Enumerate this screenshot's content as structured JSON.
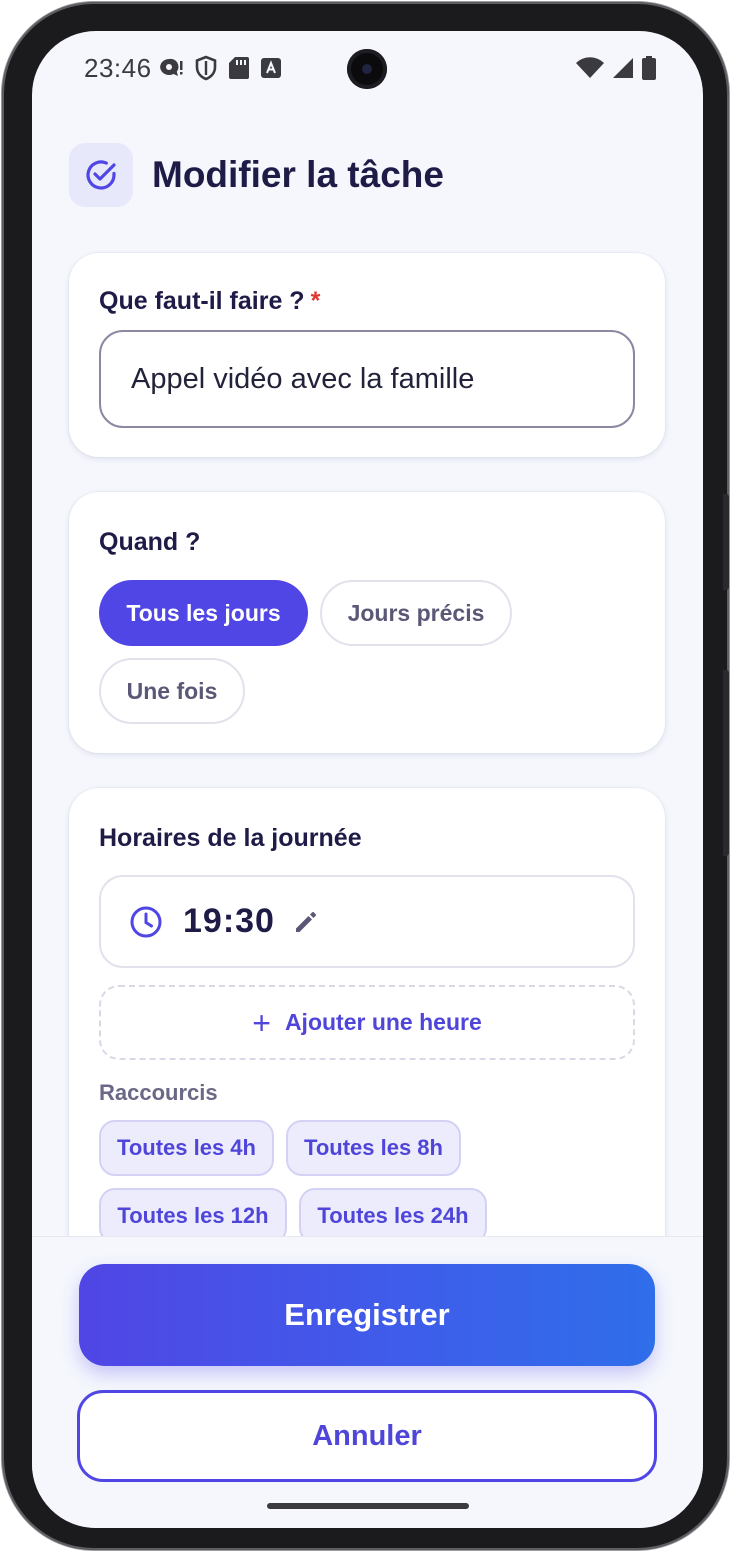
{
  "status_bar": {
    "time": "23:46"
  },
  "header": {
    "title": "Modifier la tâche",
    "icon": "check-circle-icon"
  },
  "task_card": {
    "label": "Que faut-il faire ?",
    "required_mark": "*",
    "value": "Appel vidéo avec la famille"
  },
  "when_card": {
    "label": "Quand ?",
    "options": [
      {
        "label": "Tous les jours",
        "selected": true
      },
      {
        "label": "Jours précis",
        "selected": false
      },
      {
        "label": "Une fois",
        "selected": false
      }
    ]
  },
  "schedule_card": {
    "label": "Horaires de la journée",
    "times": [
      {
        "value": "19:30"
      }
    ],
    "add_label": "Ajouter une heure",
    "add_plus": "+",
    "shortcuts_label": "Raccourcis",
    "shortcuts": [
      "Toutes les 4h",
      "Toutes les 8h",
      "Toutes les 12h",
      "Toutes les 24h"
    ]
  },
  "actions": {
    "save_label": "Enregistrer",
    "cancel_label": "Annuler"
  },
  "colors": {
    "accent": "#5046e5",
    "accent_gradient_end": "#2f6eea",
    "title": "#1e1b47",
    "required": "#e0352f",
    "screen_bg": "#f5f7fd"
  }
}
